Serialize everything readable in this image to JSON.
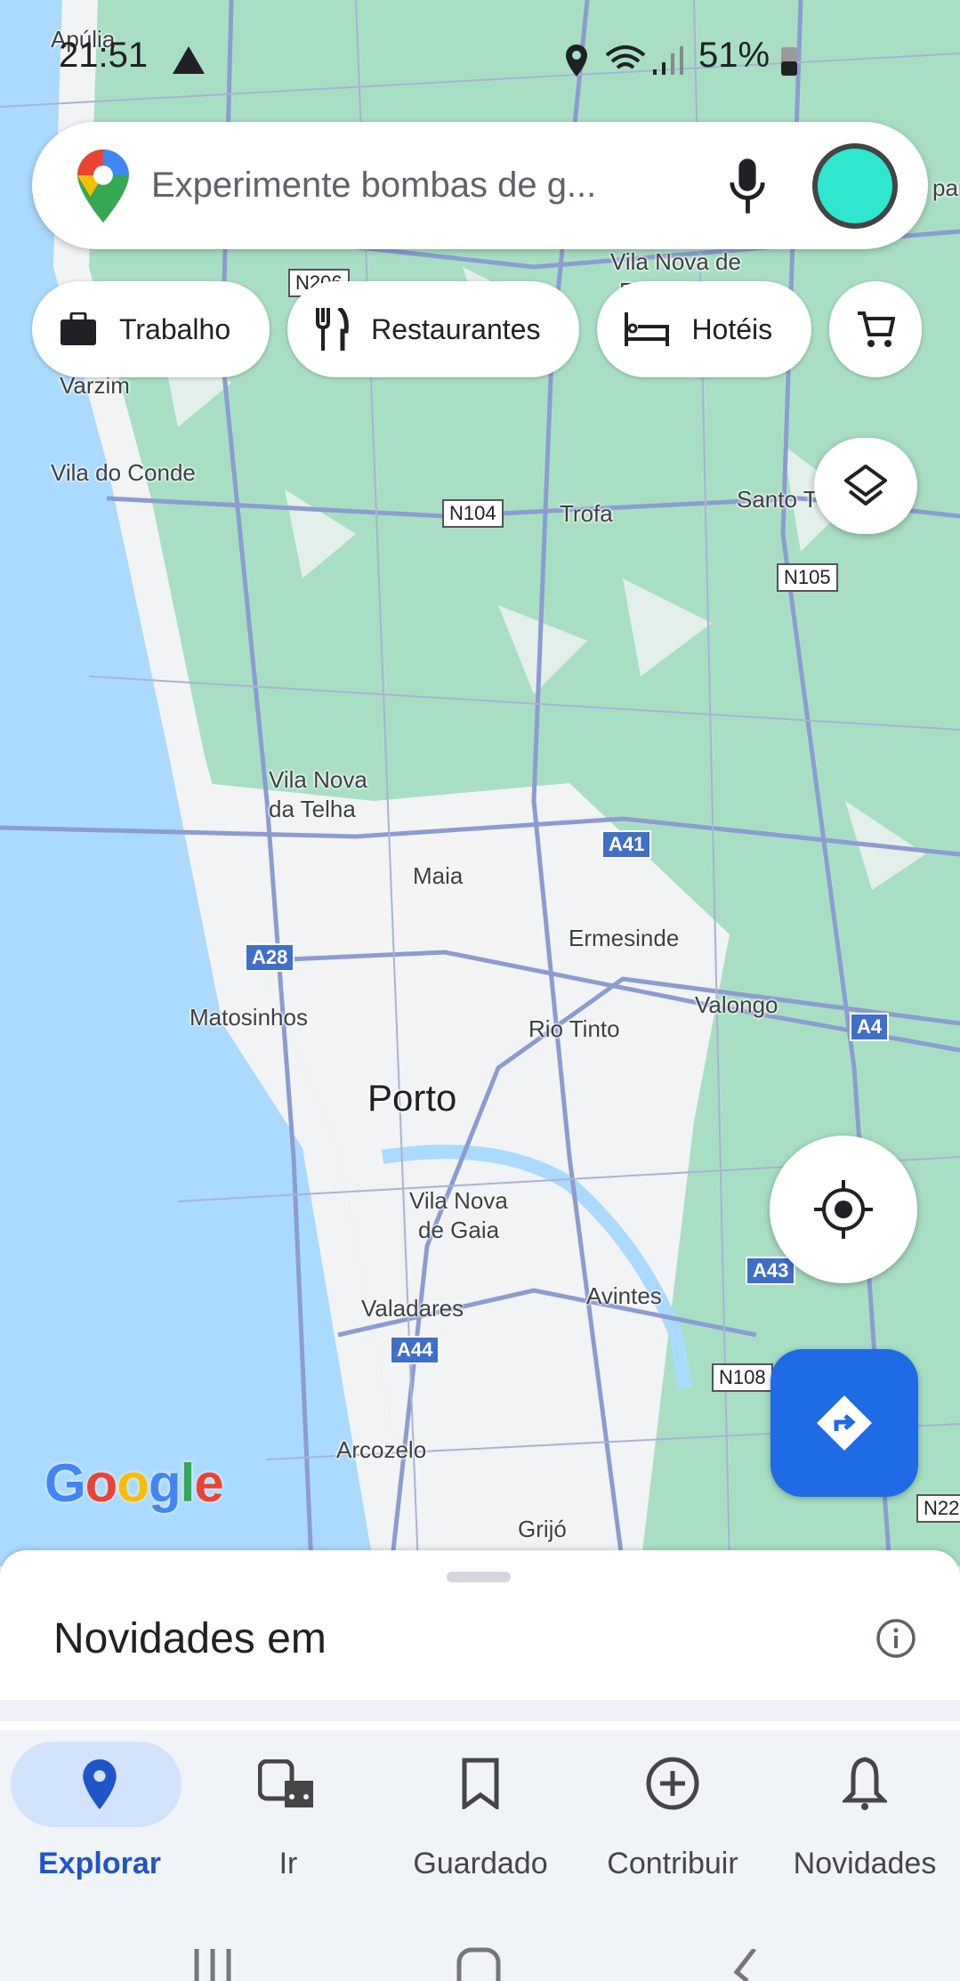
{
  "status_bar": {
    "time": "21:51",
    "battery": "51%",
    "icons": [
      "alert-icon",
      "location-icon",
      "wifi-icon",
      "signal-icon",
      "battery-icon"
    ]
  },
  "search": {
    "placeholder": "Experimente bombas de g...",
    "icons": [
      "google-maps-logo",
      "mic-icon",
      "avatar"
    ]
  },
  "chips": [
    {
      "label": "Trabalho",
      "icon": "briefcase-icon"
    },
    {
      "label": "Restaurantes",
      "icon": "restaurant-icon"
    },
    {
      "label": "Hotéis",
      "icon": "hotel-icon"
    },
    {
      "label": "",
      "icon": "cart-icon"
    }
  ],
  "map": {
    "labels": [
      "Apúlia",
      "Varzim",
      "Vila do Conde",
      "Trofa",
      "Santo T",
      "Vila Nova de",
      "Fam",
      "Vila Nova",
      "da Telha",
      "Maia",
      "Ermesinde",
      "Matosinhos",
      "Rio Tinto",
      "Valongo",
      "Porto",
      "Vila Nova",
      "de Gaia",
      "Valadares",
      "Avintes",
      "Arcozelo",
      "Grijó",
      "par"
    ],
    "shields": [
      "N104",
      "N105",
      "N206",
      "A41",
      "A28",
      "A4",
      "A43",
      "A44",
      "N108",
      "N22"
    ],
    "attribution": "Google",
    "colors": {
      "sea": "#aadaff",
      "forest": "#a8dfc4",
      "land": "#f1f3f4",
      "road": "#8c9cd0"
    }
  },
  "sheet": {
    "title": "Novidades em",
    "icon": "info-icon"
  },
  "nav": {
    "active_color": "#1f55c8",
    "items": [
      {
        "label": "Explorar",
        "icon": "explore-pin-icon",
        "active": true
      },
      {
        "label": "Ir",
        "icon": "commute-icon"
      },
      {
        "label": "Guardado",
        "icon": "bookmark-icon"
      },
      {
        "label": "Contribuir",
        "icon": "add-circle-icon"
      },
      {
        "label": "Novidades",
        "icon": "bell-icon"
      }
    ]
  },
  "system_nav": [
    "recents-icon",
    "home-icon",
    "back-icon"
  ]
}
